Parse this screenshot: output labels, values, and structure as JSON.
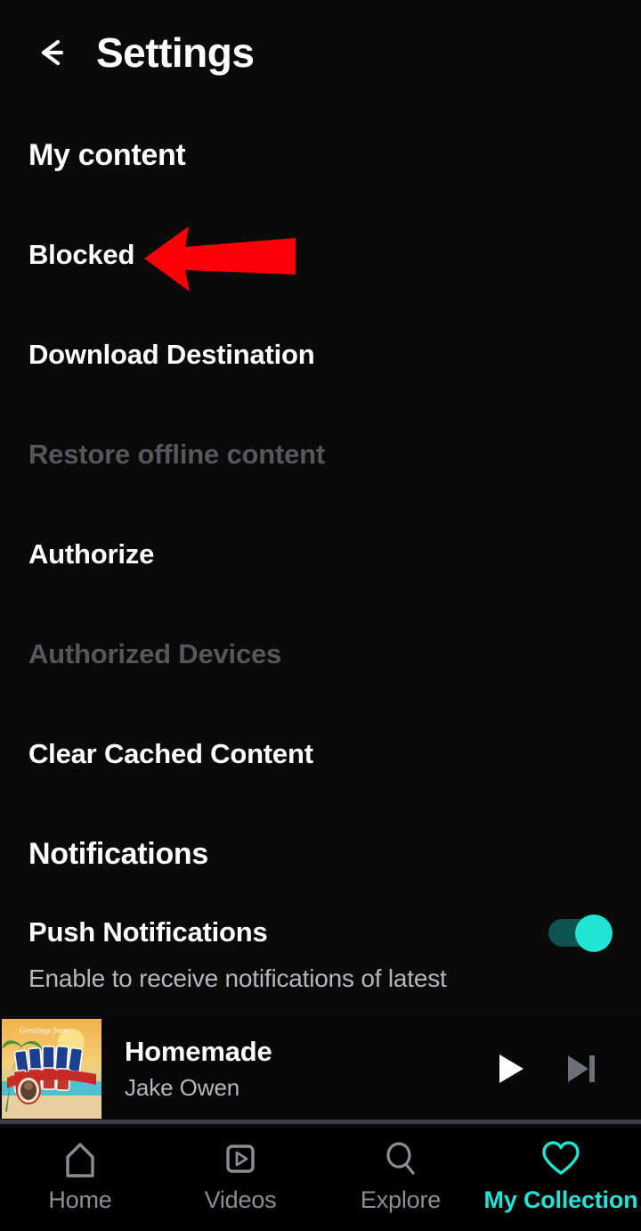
{
  "header": {
    "title": "Settings",
    "back_icon": "arrow-left-icon"
  },
  "settings": {
    "sections": [
      {
        "header": "My content",
        "items": [
          {
            "label": "Blocked",
            "disabled": false
          },
          {
            "label": "Download Destination",
            "disabled": false
          },
          {
            "label": "Restore offline content",
            "disabled": true
          },
          {
            "label": "Authorize",
            "disabled": false
          },
          {
            "label": "Authorized Devices",
            "disabled": true
          },
          {
            "label": "Clear Cached Content",
            "disabled": false
          }
        ]
      },
      {
        "header": "Notifications",
        "items": [
          {
            "label": "Push Notifications",
            "subtitle": "Enable to receive notifications of latest",
            "toggle": "on"
          }
        ]
      }
    ]
  },
  "annotation": {
    "type": "arrow",
    "color": "#fb0007",
    "points_at": "Blocked"
  },
  "now_playing": {
    "title": "Homemade",
    "artist": "Jake Owen",
    "album_art_alt": "Greetings from Jake Owen",
    "play_icon": "play-icon",
    "next_icon": "skip-next-icon"
  },
  "bottom_nav": {
    "active": "My Collection",
    "active_color": "#22e4d4",
    "items": [
      {
        "label": "Home",
        "icon": "home-icon"
      },
      {
        "label": "Videos",
        "icon": "video-icon"
      },
      {
        "label": "Explore",
        "icon": "search-icon"
      },
      {
        "label": "My Collection",
        "icon": "heart-icon"
      }
    ]
  },
  "colors": {
    "background": "#0a0a0a",
    "text_primary": "#ffffff",
    "text_secondary": "#b6b7bc",
    "text_disabled": "#56565b",
    "accent": "#22e4d4",
    "annotation": "#fb0007"
  }
}
